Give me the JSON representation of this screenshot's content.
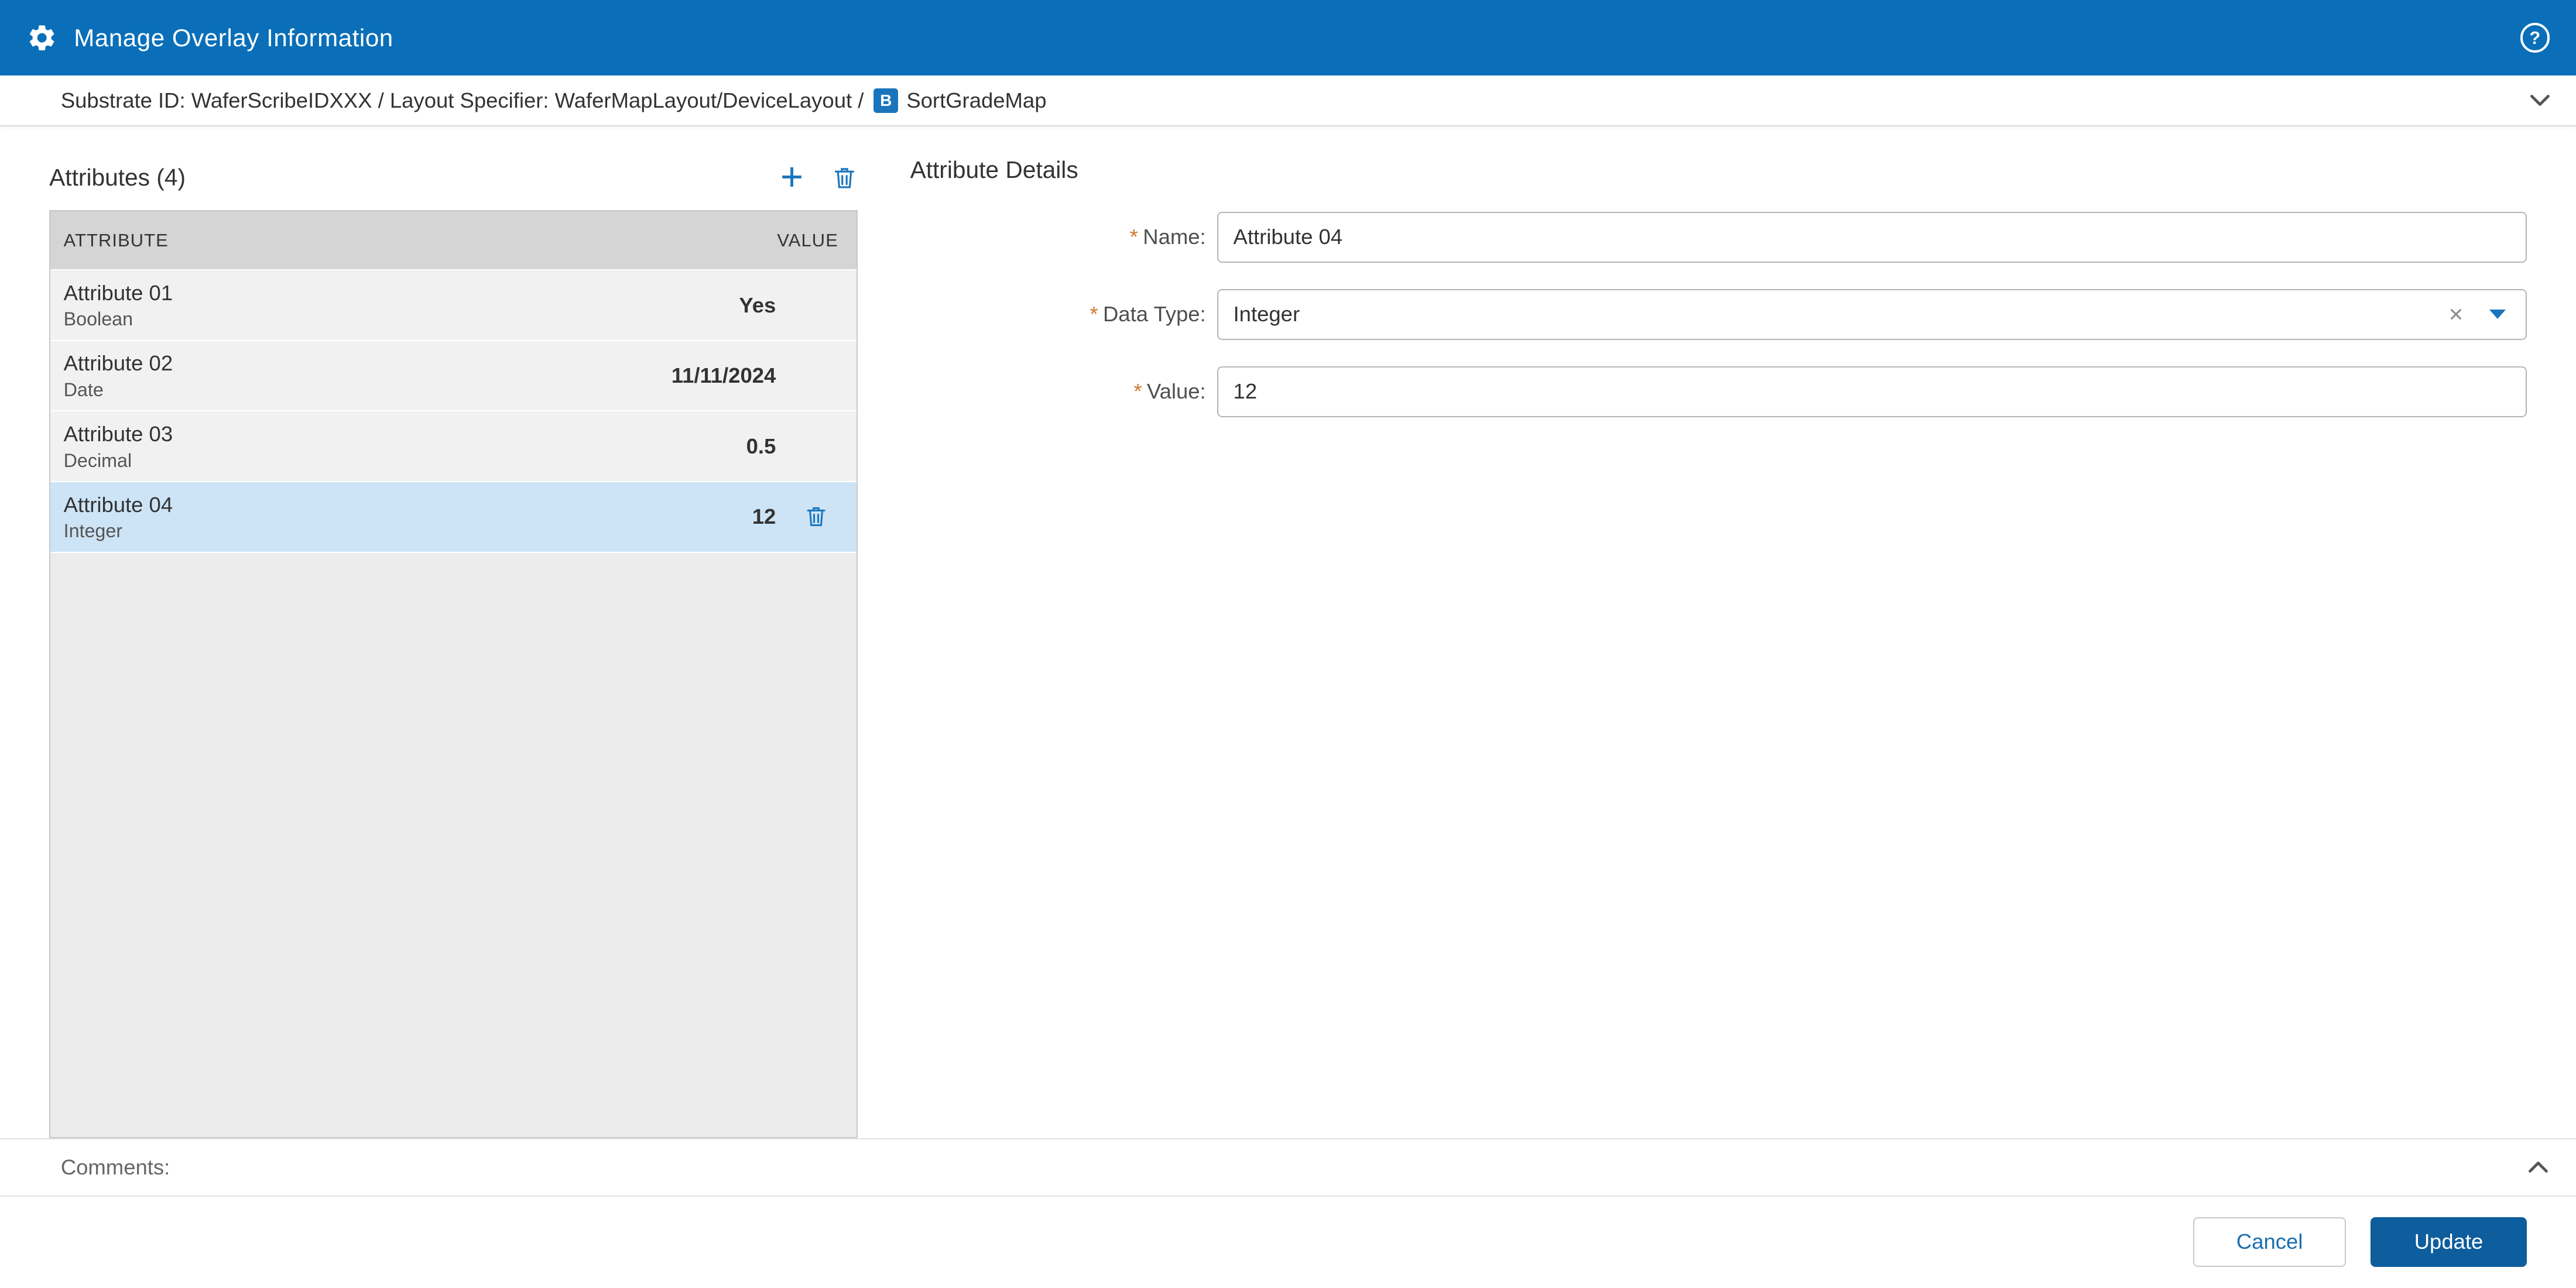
{
  "header": {
    "title": "Manage Overlay Information"
  },
  "icons": {
    "help_glyph": "?",
    "add_glyph": "+",
    "clear_glyph": "×"
  },
  "breadcrumb": {
    "text": "Substrate ID: WaferScribeIDXXX / Layout Specifier: WaferMapLayout/DeviceLayout /",
    "badge_letter": "B",
    "map_name": "SortGradeMap"
  },
  "attributes_panel": {
    "title": "Attributes (4)",
    "columns": {
      "attribute": "ATTRIBUTE",
      "value": "VALUE"
    },
    "rows": [
      {
        "name": "Attribute 01",
        "type": "Boolean",
        "value": "Yes",
        "selected": false
      },
      {
        "name": "Attribute 02",
        "type": "Date",
        "value": "11/11/2024",
        "selected": false
      },
      {
        "name": "Attribute 03",
        "type": "Decimal",
        "value": "0.5",
        "selected": false
      },
      {
        "name": "Attribute 04",
        "type": "Integer",
        "value": "12",
        "selected": true
      }
    ]
  },
  "details_panel": {
    "title": "Attribute Details",
    "required_marker": "*",
    "fields": [
      {
        "label": "Name:",
        "required": true,
        "value": "Attribute 04",
        "type": "text"
      },
      {
        "label": "Data Type:",
        "required": true,
        "value": "Integer",
        "type": "select"
      },
      {
        "label": "Value:",
        "required": true,
        "value": "12",
        "type": "text"
      }
    ]
  },
  "comments": {
    "label": "Comments:"
  },
  "footer": {
    "cancel_label": "Cancel",
    "update_label": "Update"
  },
  "colors": {
    "header_blue": "#0a6fb8",
    "accent_blue": "#1b75bc",
    "update_button_blue": "#0e5d9d",
    "selected_row_blue": "#cde4f6",
    "required_marker_orange": "#ce7a2e",
    "table_header_gray": "#d5d5d5"
  }
}
